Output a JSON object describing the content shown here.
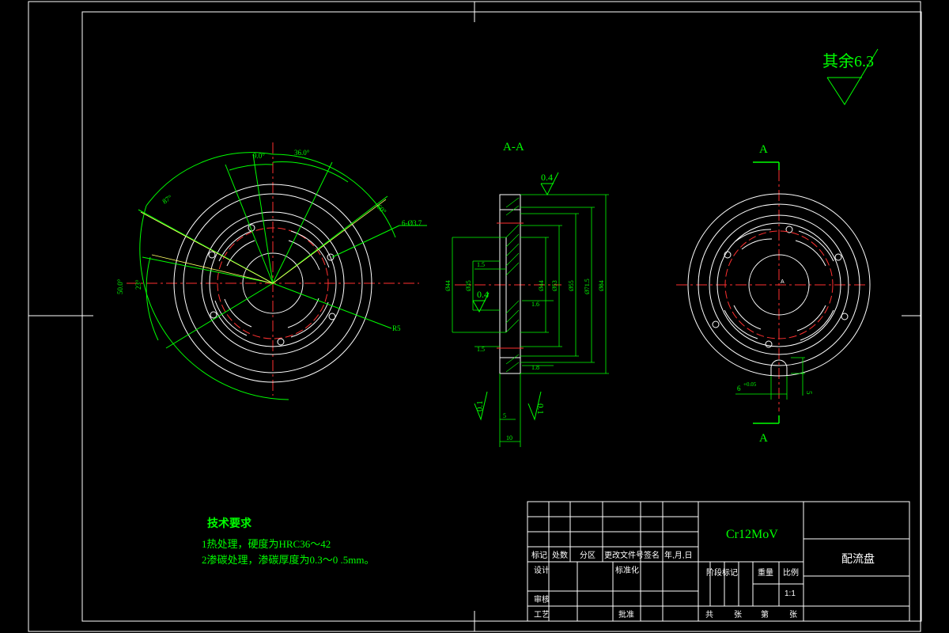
{
  "drawing": {
    "surface_roughness_note": "其余6.3",
    "section_label": "A-A",
    "section_marker_letter_top": "A",
    "section_marker_letter_bottom": "A",
    "view_center_label": "A",
    "tech_requirements_title": "技术要求",
    "tech_req_1": "1热处理，硬度为HRC36～42",
    "tech_req_2": "2渗碳处理，渗碳厚度为0.3～0 .5mm。"
  },
  "left_view": {
    "dim_top_left": "9.0°",
    "dim_top_right": "36.0°",
    "dim_upper_left": "87°",
    "dim_upper_right": "60°",
    "dim_holes": "6-Ø3.7",
    "dim_left_outer": "50.0°",
    "dim_left_inner": "23°",
    "dim_radius": "R5"
  },
  "section_view": {
    "roughness_top": "0.4",
    "roughness_mid": "0.4",
    "roughness_bl": "0.1",
    "roughness_br": "0.1",
    "dim_1_5_top": "1.5",
    "dim_1_6": "1.6",
    "dim_1_5_bottom": "1.5",
    "dim_1_8": "1.8",
    "dim_5": "5",
    "dim_10": "10",
    "dia_44_left": "Ø44",
    "dia_35": "Ø35",
    "dia_44_inner": "Ø44",
    "dia_53": "Ø53",
    "dia_55": "Ø55",
    "dia_71": "Ø71.5",
    "dia_84": "Ø84"
  },
  "right_view": {
    "dim_slot_width": "6",
    "dim_slot_tol": "+0.05",
    "dim_slot_depth": "5"
  },
  "title_block": {
    "material": "Cr12MoV",
    "part_name": "配流盘",
    "col_mark": "标记",
    "col_count": "处数",
    "col_zone": "分区",
    "col_change_doc": "更改文件号",
    "col_sign": "签名",
    "col_date": "年,月,日",
    "row_design": "设计",
    "row_standardize": "标准化",
    "row_review": "审核",
    "row_process": "工艺",
    "row_approve": "批准",
    "stage_mark": "阶段标记",
    "weight": "重量",
    "scale": "比例",
    "scale_value": "1:1",
    "sheet_total": "共",
    "sheet_zhang1": "张",
    "sheet_di": "第",
    "sheet_zhang2": "张"
  }
}
